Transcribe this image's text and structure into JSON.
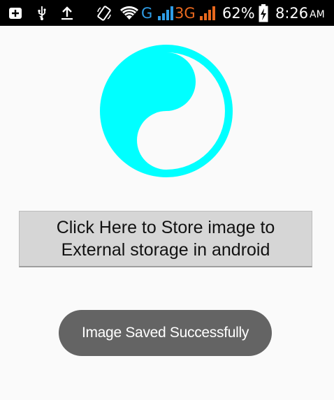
{
  "status_bar": {
    "network_g": "G",
    "network_3g": "3G",
    "battery_percent": "62%",
    "time": "8:26",
    "ampm": "AM",
    "icons": [
      "notification-plus-icon",
      "usb-icon",
      "upload-icon",
      "rotation-icon",
      "wifi-icon",
      "signal-icon",
      "battery-charging-icon"
    ]
  },
  "main": {
    "image_icon": "yin-yang-icon",
    "image_color": "#00ffff",
    "store_button_label": "Click Here to Store image to External storage in android"
  },
  "toast": {
    "message": "Image Saved Successfully"
  }
}
